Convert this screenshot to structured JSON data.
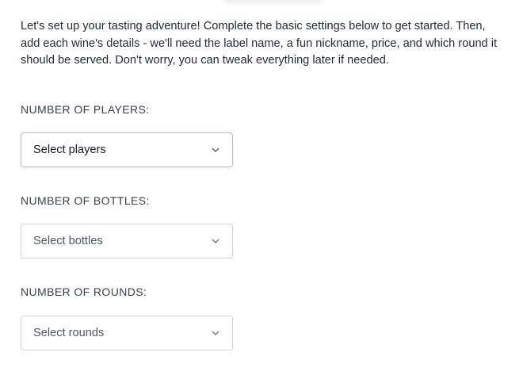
{
  "intro_text": "Let's set up your tasting adventure! Complete the basic settings below to get started. Then, add each wine's details - we'll need the label name, a fun nickname, price, and which round it should be served. Don't worry, you can tweak everything later if needed.",
  "fields": [
    {
      "label": "NUMBER OF PLAYERS:",
      "placeholder": "Select players"
    },
    {
      "label": "NUMBER OF BOTTLES:",
      "placeholder": "Select bottles"
    },
    {
      "label": "NUMBER OF ROUNDS:",
      "placeholder": "Select rounds"
    }
  ],
  "icons": {
    "dropdown": "chevron-down-icon"
  }
}
